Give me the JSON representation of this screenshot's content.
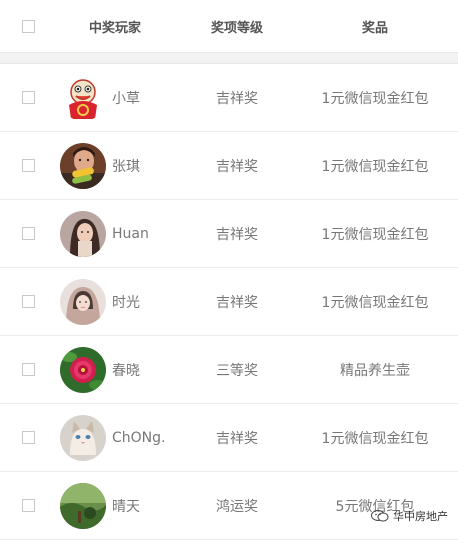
{
  "header": {
    "player": "中奖玩家",
    "level": "奖项等级",
    "prize": "奖品"
  },
  "rows": [
    {
      "name": "小草",
      "level": "吉祥奖",
      "prize": "1元微信现金红包",
      "avatar": "cartoon-mascot"
    },
    {
      "name": "张琪",
      "level": "吉祥奖",
      "prize": "1元微信现金红包",
      "avatar": "person-with-corn"
    },
    {
      "name": "Huan",
      "level": "吉祥奖",
      "prize": "1元微信现金红包",
      "avatar": "person-portrait"
    },
    {
      "name": "时光",
      "level": "吉祥奖",
      "prize": "1元微信现金红包",
      "avatar": "girl-hood"
    },
    {
      "name": "春晓",
      "level": "三等奖",
      "prize": "精品养生壶",
      "avatar": "red-flower"
    },
    {
      "name": "ChONg.",
      "level": "吉祥奖",
      "prize": "1元微信现金红包",
      "avatar": "cat"
    },
    {
      "name": "晴天",
      "level": "鸿运奖",
      "prize": "5元微信红包",
      "avatar": "landscape"
    }
  ],
  "watermark": "华中房地产",
  "icons": [
    "checkbox-icon",
    "wechat-icon"
  ]
}
